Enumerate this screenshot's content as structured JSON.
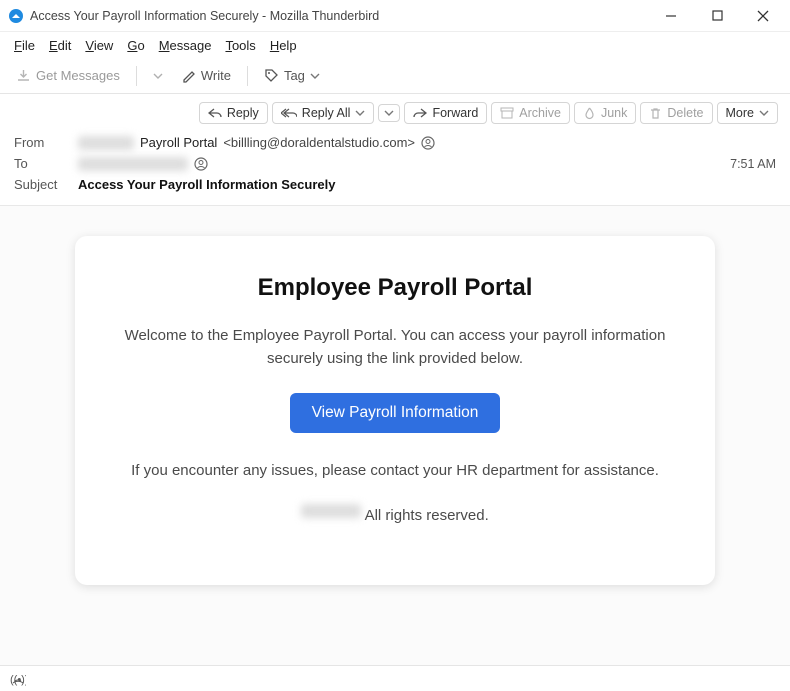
{
  "window": {
    "title": "Access Your Payroll Information Securely - Mozilla Thunderbird"
  },
  "menubar": [
    "File",
    "Edit",
    "View",
    "Go",
    "Message",
    "Tools",
    "Help"
  ],
  "toolbar": {
    "get_messages": "Get Messages",
    "write": "Write",
    "tag": "Tag"
  },
  "actions": {
    "reply": "Reply",
    "reply_all": "Reply All",
    "forward": "Forward",
    "archive": "Archive",
    "junk": "Junk",
    "delete": "Delete",
    "more": "More"
  },
  "headers": {
    "from_label": "From",
    "from_name": "Payroll Portal",
    "from_addr": "<billling@doraldentalstudio.com>",
    "to_label": "To",
    "time": "7:51 AM",
    "subject_label": "Subject",
    "subject": "Access Your Payroll Information Securely"
  },
  "email": {
    "title": "Employee Payroll Portal",
    "intro": "Welcome to the Employee Payroll Portal. You can access your payroll information securely using the link provided below.",
    "button": "View Payroll Information",
    "help": "If you encounter any issues, please contact your HR department for assistance.",
    "rights": " All rights reserved."
  }
}
